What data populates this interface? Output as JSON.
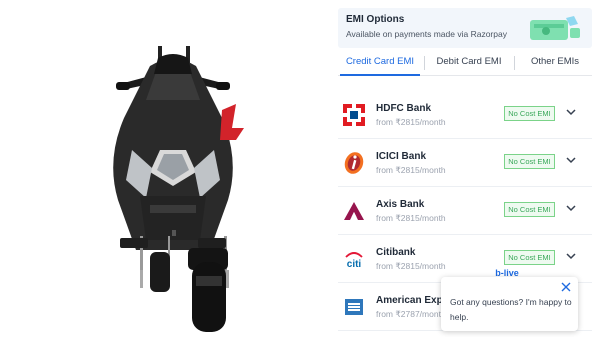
{
  "emi": {
    "title": "EMI Options",
    "subtitle": "Available on payments made via Razorpay"
  },
  "tabs": [
    {
      "label": "Credit Card EMI",
      "active": true
    },
    {
      "label": "Debit Card EMI",
      "active": false
    },
    {
      "label": "Other EMIs",
      "active": false
    }
  ],
  "banks": [
    {
      "name": "HDFC Bank",
      "from": "from ₹2815/month",
      "badge": "No Cost EMI",
      "icon": "hdfc-logo-icon"
    },
    {
      "name": "ICICI Bank",
      "from": "from ₹2815/month",
      "badge": "No Cost EMI",
      "icon": "icici-logo-icon"
    },
    {
      "name": "Axis Bank",
      "from": "from ₹2815/month",
      "badge": "No Cost EMI",
      "icon": "axis-logo-icon"
    },
    {
      "name": "Citibank",
      "from": "from ₹2815/month",
      "badge": "No Cost EMI",
      "icon": "citi-logo-icon"
    },
    {
      "name": "American Express",
      "from": "from ₹2787/month",
      "badge": "",
      "icon": "amex-logo-icon"
    }
  ],
  "chat": {
    "message": "Got any questions? I'm happy to help.",
    "badge_text": "b-live"
  },
  "colors": {
    "accent": "#1e6ae0",
    "nocost_border": "#7bd389",
    "nocost_text": "#3aa85a",
    "header_bg": "#f2f6fb"
  }
}
